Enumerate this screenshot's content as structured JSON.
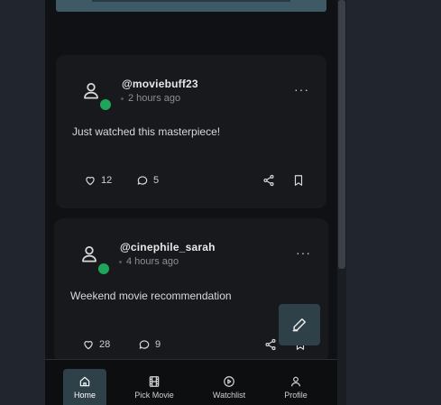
{
  "posts": [
    {
      "username": "@moviebuff23",
      "time": "2 hours ago",
      "text": "Just watched this masterpiece!",
      "likes": "12",
      "comments": "5",
      "more": "···"
    },
    {
      "username": "@cinephile_sarah",
      "time": "4 hours ago",
      "text": "Weekend movie recommendation",
      "likes": "28",
      "comments": "9",
      "more": "···"
    }
  ],
  "nav": {
    "items": [
      {
        "label": "Home",
        "icon": "home-icon",
        "active": true
      },
      {
        "label": "Pick Movie",
        "icon": "film-icon",
        "active": false
      },
      {
        "label": "Watchlist",
        "icon": "play-circle-icon",
        "active": false
      },
      {
        "label": "Profile",
        "icon": "user-icon",
        "active": false
      }
    ]
  },
  "colors": {
    "accent": "#2e4048",
    "online": "#20a35a",
    "card": "#17191c",
    "background": "#0f1114"
  }
}
